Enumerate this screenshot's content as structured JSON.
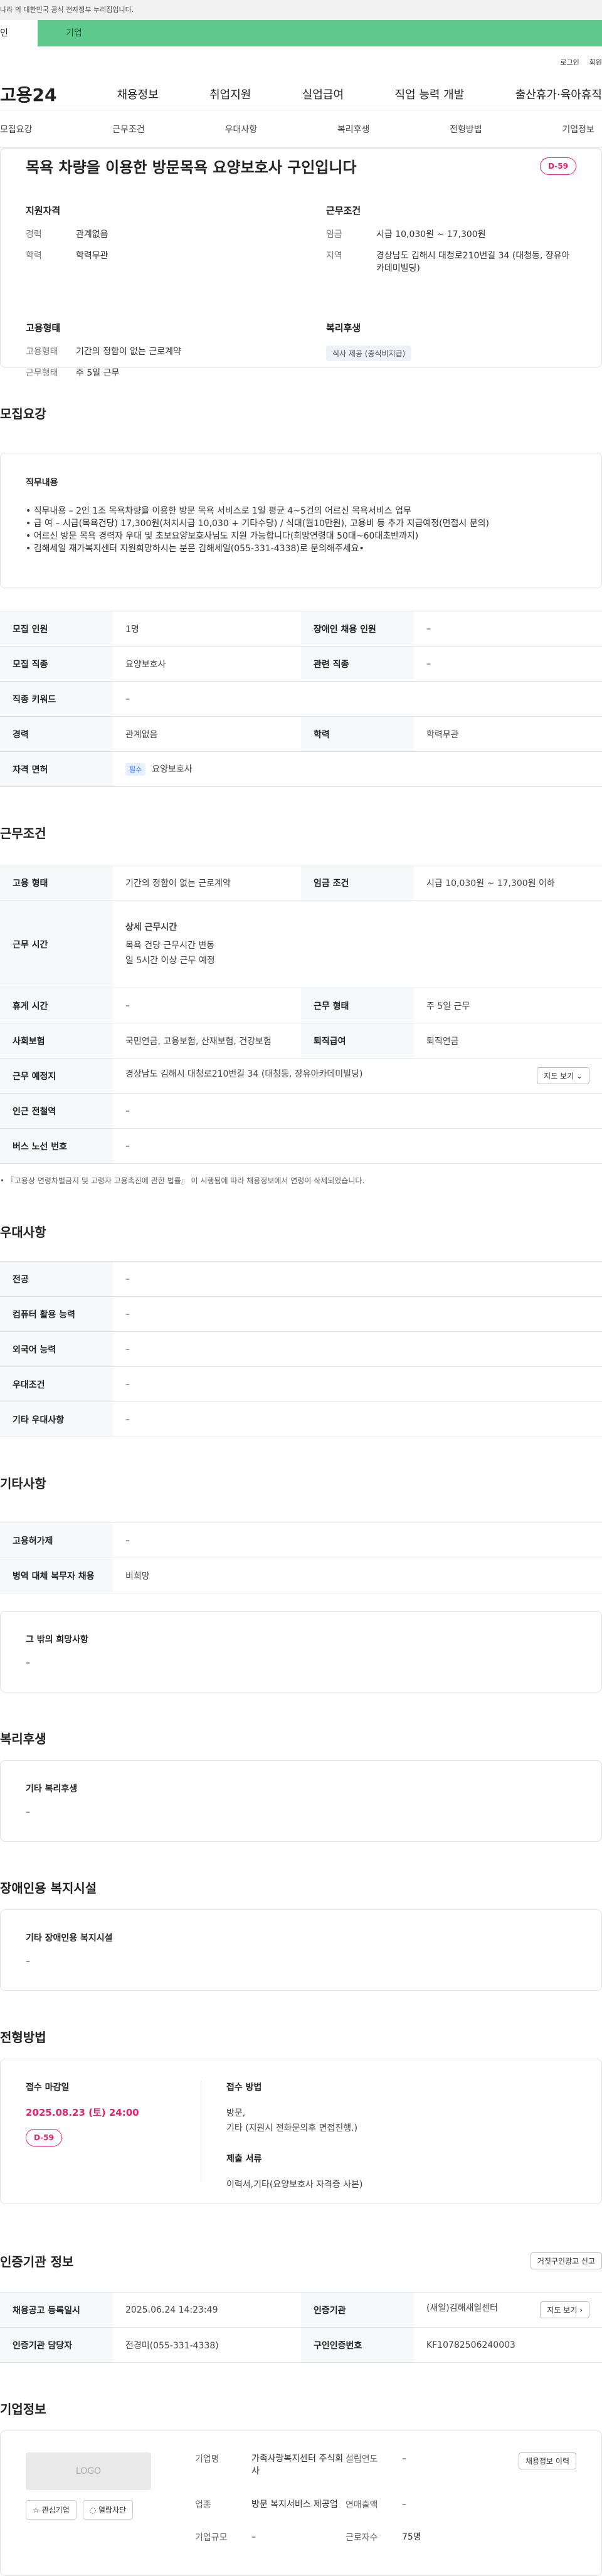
{
  "gov_notice": "나라 의 대한민국 공식 전자정부 누리집입니다.",
  "user_tabs": [
    "인",
    "기업"
  ],
  "util_links": [
    "로그인",
    "회원"
  ],
  "gnb": {
    "logo": "고용24",
    "menu": [
      "채용정보",
      "취업지원",
      "실업급여",
      "직업 능력 개발",
      "출산휴가·육아휴직"
    ]
  },
  "subtabs": [
    "모집요강",
    "근무조건",
    "우대사항",
    "복리후생",
    "전형방법",
    "기업정보"
  ],
  "job": {
    "title": "목욕 차량을 이용한 방문목욕 요양보호사 구인입니다",
    "dday": "D-59",
    "qual_title": "지원자격",
    "qual": [
      {
        "k": "경력",
        "v": "관계없음"
      },
      {
        "k": "학력",
        "v": "학력무관"
      }
    ],
    "cond_title": "근무조건",
    "cond": [
      {
        "k": "임금",
        "v": "시급 10,030원 ~ 17,300원"
      },
      {
        "k": "지역",
        "v": "경상남도 김해시 대청로210번길 34 (대청동, 장유아카데미빌딩)"
      }
    ],
    "emp_title": "고용형태",
    "emp": [
      {
        "k": "고용형태",
        "v": "기간의 정함이 없는 근로계약"
      },
      {
        "k": "근무형태",
        "v": "주 5일 근무"
      }
    ],
    "welfare_title": "복리후생",
    "welfare_chip": "식사 제공 (중식비지급)"
  },
  "recruit": {
    "section": "모집요강",
    "duty_title": "직무내용",
    "duty_lines": [
      "• 직무내용 – 2인 1조 목욕차량을 이용한 방문 목욕 서비스로 1일 평균 4~5건의 어르신 목욕서비스 업무",
      "• 급 여 – 시급(목욕건당) 17,300원(처치시급 10,030 + 기타수당) / 식대(월10만원), 고용비 등 추가 지급예정(면접시 문의)",
      "• 어르신 방문 목욕 경력자 우대 및 초보요양보호사님도 지원 가능합니다(희망연령대 50대~60대초반까지)",
      "• 김해세일 재가복지센터 지원희망하시는 분은 김해세일(055-331-4338)로 문의해주세요•"
    ],
    "rows": [
      {
        "k1": "모집 인원",
        "v1": "1명",
        "k2": "장애인 채용 인원",
        "v2": "–"
      },
      {
        "k1": "모집 직종",
        "v1": "요양보호사",
        "k2": "관련 직종",
        "v2": "–"
      },
      {
        "k1": "직종 키워드",
        "v1": "–"
      },
      {
        "k1": "경력",
        "v1": "관계없음",
        "k2": "학력",
        "v2": "학력무관"
      }
    ],
    "license_k": "자격 면허",
    "license_badge": "필수",
    "license_v": "요양보호사"
  },
  "work": {
    "section": "근무조건",
    "emp_k": "고용 형태",
    "emp_v": "기간의 정함이 없는 근로계약",
    "wage_k": "임금 조건",
    "wage_v": "시급 10,030원 ~ 17,300원 이하",
    "time_k": "근무 시간",
    "time_title": "상세 근무시간",
    "time_lines": [
      "목욕 건당 근무시간 변동",
      "일 5시간 이상 근무 예정"
    ],
    "rest_k": "휴게 시간",
    "rest_v": "–",
    "type_k": "근무 형태",
    "type_v": "주 5일 근무",
    "ins_k": "사회보험",
    "ins_v": "국민연금, 고용보험, 산재보험, 건강보험",
    "ret_k": "퇴직급여",
    "ret_v": "퇴직연금",
    "place_k": "근무 예정지",
    "place_v": "경상남도 김해시 대청로210번길 34 (대청동, 장유아카데미빌딩)",
    "map_btn": "지도 보기 ⌄",
    "subway_k": "인근 전철역",
    "subway_v": "–",
    "bus_k": "버스 노선 번호",
    "bus_v": "–",
    "note": "• 『고용상 연령차별금지 및 고령자 고용촉진에 관한 법률』 이 시행됨에 따라 채용정보에서 연령이 삭제되었습니다."
  },
  "pref": {
    "section": "우대사항",
    "rows": [
      {
        "k": "전공",
        "v": "–"
      },
      {
        "k": "컴퓨터 활용 능력",
        "v": "–"
      },
      {
        "k": "외국어 능력",
        "v": "–"
      },
      {
        "k": "우대조건",
        "v": "–"
      },
      {
        "k": "기타 우대사항",
        "v": "–"
      }
    ]
  },
  "etc": {
    "section": "기타사항",
    "rows": [
      {
        "k": "고용허가제",
        "v": "–"
      },
      {
        "k": "병역 대체 복무자 채용",
        "v": "비희망"
      }
    ],
    "other_title": "그 밖의 희망사항",
    "other_v": "–"
  },
  "benefit": {
    "section": "복리후생",
    "title": "기타 복리후생",
    "v": "–"
  },
  "facility": {
    "section": "장애인용 복지시설",
    "title": "기타 장애인용 복지시설",
    "v": "–"
  },
  "apply": {
    "section": "전형방법",
    "deadline_title": "접수 마감일",
    "deadline": "2025.08.23 (토) 24:00",
    "dday": "D-59",
    "method_title": "접수 방법",
    "method_lines": [
      "방문,",
      "기타 (지원시 전화문의후 면접진행.)"
    ],
    "docs_title": "제출 서류",
    "docs": "이력서,기타(요양보호사 자격증 사본)"
  },
  "inst": {
    "section": "인증기관 정보",
    "report_btn": "거짓구인광고 신고",
    "reg_k": "채용공고 등록일시",
    "reg_v": "2025.06.24 14:23:49",
    "org_k": "인증기관",
    "org_v": "(새일)김해새일센터",
    "map_btn": "지도 보기 ›",
    "mgr_k": "인증기관 담당자",
    "mgr_v": "전경미(055-331-4338)",
    "no_k": "구인인증번호",
    "no_v": "KF10782506240003"
  },
  "company": {
    "section": "기업정보",
    "logo": "LOGO",
    "fav_btn": "☆ 관심기업",
    "block_btn": "◌ 열람차단",
    "name_k": "기업명",
    "name_v": "가족사랑복지센터 주식회사",
    "year_k": "설립연도",
    "year_v": "–",
    "ind_k": "업종",
    "ind_v": "방문 복지서비스 제공업",
    "sales_k": "연매출액",
    "sales_v": "–",
    "emp_k": "근로자수",
    "emp_v": "75명",
    "size_k": "기업규모",
    "size_v": "–",
    "hist_btn": "채용정보 이력"
  }
}
